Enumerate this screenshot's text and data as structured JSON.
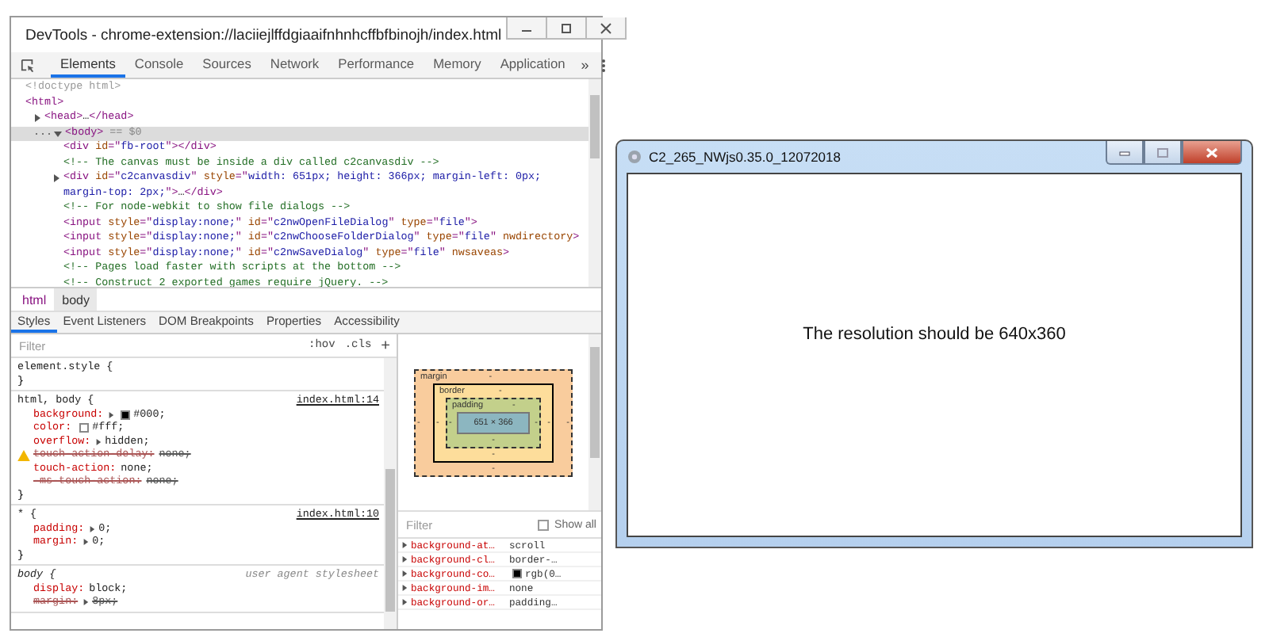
{
  "devtools": {
    "title": "DevTools - chrome-extension://laciiejlffdgiaaifnhnhcffbfbinojh/index.html",
    "tabs": [
      {
        "label": "Elements",
        "selected": true
      },
      {
        "label": "Console",
        "selected": false
      },
      {
        "label": "Sources",
        "selected": false
      },
      {
        "label": "Network",
        "selected": false
      },
      {
        "label": "Performance",
        "selected": false
      },
      {
        "label": "Memory",
        "selected": false
      },
      {
        "label": "Application",
        "selected": false
      }
    ],
    "more_tabs": "»",
    "dom_tree": [
      {
        "selected": false,
        "tokens": [
          {
            "kind": "doctype",
            "text": "<!doctype html>"
          }
        ]
      },
      {
        "selected": false,
        "tokens": [
          {
            "kind": "tag",
            "text": "<html>"
          }
        ],
        "children": [
          {
            "selected": false,
            "expanded": false,
            "tokens": [
              {
                "kind": "tag",
                "text": "<head>"
              },
              {
                "kind": "plain",
                "text": "…"
              },
              {
                "kind": "tag",
                "text": "</head>"
              }
            ]
          },
          {
            "selected": true,
            "marker": "...",
            "expanded": true,
            "tokens": [
              {
                "kind": "tag",
                "text": "<body>"
              },
              {
                "kind": "muted",
                "text": " == $0"
              }
            ],
            "children": [
              {
                "selected": false,
                "tokens": [
                  {
                    "kind": "tag",
                    "text": "<div "
                  },
                  {
                    "kind": "attr",
                    "text": "id"
                  },
                  {
                    "kind": "tag",
                    "text": "=\""
                  },
                  {
                    "kind": "value",
                    "text": "fb-root"
                  },
                  {
                    "kind": "tag",
                    "text": "\"></div>"
                  }
                ]
              },
              {
                "selected": false,
                "tokens": [
                  {
                    "kind": "comment",
                    "text": "<!-- The canvas must be inside a div called c2canvasdiv -->"
                  }
                ]
              },
              {
                "selected": false,
                "expanded": false,
                "tokens": [
                  {
                    "kind": "tag",
                    "text": "<div "
                  },
                  {
                    "kind": "attr",
                    "text": "id"
                  },
                  {
                    "kind": "tag",
                    "text": "=\""
                  },
                  {
                    "kind": "value",
                    "text": "c2canvasdiv"
                  },
                  {
                    "kind": "tag",
                    "text": "\" "
                  },
                  {
                    "kind": "attr",
                    "text": "style"
                  },
                  {
                    "kind": "tag",
                    "text": "=\""
                  },
                  {
                    "kind": "value",
                    "text": "width: 651px; height: 366px; margin-left: 0px; margin-top: 2px;"
                  },
                  {
                    "kind": "tag",
                    "text": "\">"
                  },
                  {
                    "kind": "plain",
                    "text": "…"
                  },
                  {
                    "kind": "tag",
                    "text": "</div>"
                  }
                ]
              },
              {
                "selected": false,
                "tokens": [
                  {
                    "kind": "comment",
                    "text": "<!-- For node-webkit to show file dialogs -->"
                  }
                ]
              },
              {
                "selected": false,
                "tokens": [
                  {
                    "kind": "tag",
                    "text": "<input "
                  },
                  {
                    "kind": "attr",
                    "text": "style"
                  },
                  {
                    "kind": "tag",
                    "text": "=\""
                  },
                  {
                    "kind": "value",
                    "text": "display:none;"
                  },
                  {
                    "kind": "tag",
                    "text": "\" "
                  },
                  {
                    "kind": "attr",
                    "text": "id"
                  },
                  {
                    "kind": "tag",
                    "text": "=\""
                  },
                  {
                    "kind": "value",
                    "text": "c2nwOpenFileDialog"
                  },
                  {
                    "kind": "tag",
                    "text": "\" "
                  },
                  {
                    "kind": "attr",
                    "text": "type"
                  },
                  {
                    "kind": "tag",
                    "text": "=\""
                  },
                  {
                    "kind": "value",
                    "text": "file"
                  },
                  {
                    "kind": "tag",
                    "text": "\">"
                  }
                ]
              },
              {
                "selected": false,
                "tokens": [
                  {
                    "kind": "tag",
                    "text": "<input "
                  },
                  {
                    "kind": "attr",
                    "text": "style"
                  },
                  {
                    "kind": "tag",
                    "text": "=\""
                  },
                  {
                    "kind": "value",
                    "text": "display:none;"
                  },
                  {
                    "kind": "tag",
                    "text": "\" "
                  },
                  {
                    "kind": "attr",
                    "text": "id"
                  },
                  {
                    "kind": "tag",
                    "text": "=\""
                  },
                  {
                    "kind": "value",
                    "text": "c2nwChooseFolderDialog"
                  },
                  {
                    "kind": "tag",
                    "text": "\" "
                  },
                  {
                    "kind": "attr",
                    "text": "type"
                  },
                  {
                    "kind": "tag",
                    "text": "=\""
                  },
                  {
                    "kind": "value",
                    "text": "file"
                  },
                  {
                    "kind": "tag",
                    "text": "\" "
                  },
                  {
                    "kind": "attr",
                    "text": "nwdirectory"
                  },
                  {
                    "kind": "tag",
                    "text": ">"
                  }
                ]
              },
              {
                "selected": false,
                "tokens": [
                  {
                    "kind": "tag",
                    "text": "<input "
                  },
                  {
                    "kind": "attr",
                    "text": "style"
                  },
                  {
                    "kind": "tag",
                    "text": "=\""
                  },
                  {
                    "kind": "value",
                    "text": "display:none;"
                  },
                  {
                    "kind": "tag",
                    "text": "\" "
                  },
                  {
                    "kind": "attr",
                    "text": "id"
                  },
                  {
                    "kind": "tag",
                    "text": "=\""
                  },
                  {
                    "kind": "value",
                    "text": "c2nwSaveDialog"
                  },
                  {
                    "kind": "tag",
                    "text": "\" "
                  },
                  {
                    "kind": "attr",
                    "text": "type"
                  },
                  {
                    "kind": "tag",
                    "text": "=\""
                  },
                  {
                    "kind": "value",
                    "text": "file"
                  },
                  {
                    "kind": "tag",
                    "text": "\" "
                  },
                  {
                    "kind": "attr",
                    "text": "nwsaveas"
                  },
                  {
                    "kind": "tag",
                    "text": ">"
                  }
                ]
              },
              {
                "selected": false,
                "tokens": [
                  {
                    "kind": "comment",
                    "text": "<!-- Pages load faster with scripts at the bottom -->"
                  }
                ]
              },
              {
                "selected": false,
                "tokens": [
                  {
                    "kind": "comment",
                    "text": "<!-- Construct 2 exported games require jQuery. -->"
                  }
                ]
              }
            ]
          }
        ]
      }
    ],
    "breadcrumbs": [
      {
        "label": "html",
        "selected": false
      },
      {
        "label": "body",
        "selected": true
      }
    ],
    "subtabs": [
      {
        "label": "Styles",
        "selected": true
      },
      {
        "label": "Event Listeners",
        "selected": false
      },
      {
        "label": "DOM Breakpoints",
        "selected": false
      },
      {
        "label": "Properties",
        "selected": false
      },
      {
        "label": "Accessibility",
        "selected": false
      }
    ],
    "styles_filter": {
      "placeholder": "Filter"
    },
    "hov": ":hov",
    "cls": ".cls",
    "add": "+",
    "rules": [
      {
        "kind": "inline",
        "selector": "element.style {",
        "close": "}"
      },
      {
        "kind": "author",
        "selector": "html, body {",
        "source": "index.html:14",
        "props": [
          {
            "name": "background:",
            "value": "#000;",
            "expandable": true,
            "color": "#000000",
            "overridden": false,
            "kind": "plain"
          },
          {
            "name": "color:",
            "value": "#fff;",
            "expandable": false,
            "color": "#ffffff",
            "overridden": false,
            "kind": "plain"
          },
          {
            "name": "overflow:",
            "value": "hidden;",
            "expandable": true,
            "overridden": false,
            "kind": "plain"
          },
          {
            "name": "touch-action-delay:",
            "value": "none;",
            "expandable": false,
            "overridden": true,
            "kind": "warning"
          },
          {
            "name": "touch-action:",
            "value": "none;",
            "expandable": false,
            "overridden": false,
            "kind": "plain"
          },
          {
            "name": "-ms-touch-action:",
            "value": "none;",
            "expandable": false,
            "overridden": true,
            "kind": "plain"
          }
        ],
        "close": "}"
      },
      {
        "kind": "author",
        "selector": "* {",
        "source": "index.html:10",
        "props": [
          {
            "name": "padding:",
            "value": "0;",
            "expandable": true,
            "overridden": false,
            "kind": "plain"
          },
          {
            "name": "margin:",
            "value": "0;",
            "expandable": true,
            "overridden": false,
            "kind": "plain"
          }
        ],
        "close": "}"
      },
      {
        "kind": "agent",
        "selector": "body {",
        "source": "user agent stylesheet",
        "props": [
          {
            "name": "display:",
            "value": "block;",
            "expandable": false,
            "overridden": false,
            "kind": "plain"
          },
          {
            "name": "margin:",
            "value": "8px;",
            "expandable": true,
            "overridden": true,
            "kind": "plain"
          }
        ]
      }
    ],
    "box_model": {
      "margin": {
        "label": "margin",
        "top": "-",
        "bottom": "-",
        "left": "-",
        "right": "-"
      },
      "border": {
        "label": "border",
        "top": "-",
        "bottom": "-",
        "left": "-",
        "right": "-"
      },
      "padding": {
        "label": "padding",
        "top": "-",
        "bottom": "-",
        "left": "-",
        "right": "-"
      },
      "content": "651 × 366"
    },
    "computed_filter": {
      "placeholder": "Filter"
    },
    "show_all": {
      "label": "Show all",
      "checked": false
    },
    "computed": [
      {
        "name": "background-at…",
        "value": "scroll"
      },
      {
        "name": "background-cl…",
        "value": "border-…"
      },
      {
        "name": "background-co…",
        "value": "rgb(0…",
        "color": "#000000"
      },
      {
        "name": "background-im…",
        "value": "none"
      },
      {
        "name": "background-or…",
        "value": "padding…"
      }
    ]
  },
  "app": {
    "title": "C2_265_NWjs0.35.0_12072018",
    "message": "The resolution should be 640x360"
  }
}
